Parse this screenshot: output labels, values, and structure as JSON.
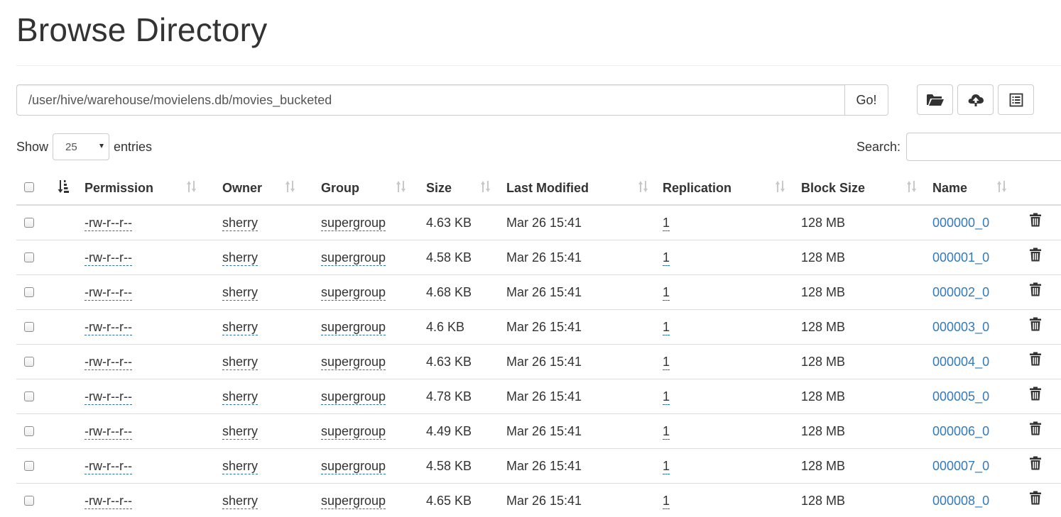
{
  "page": {
    "title": "Browse Directory"
  },
  "path_bar": {
    "value": "/user/hive/warehouse/movielens.db/movies_bucketed",
    "go_label": "Go!"
  },
  "toolbar": {
    "buttons": [
      {
        "name": "create-directory-button",
        "icon": "folder-open-icon"
      },
      {
        "name": "upload-button",
        "icon": "cloud-upload-icon"
      },
      {
        "name": "cut-paste-button",
        "icon": "list-icon"
      }
    ]
  },
  "table_controls": {
    "show_label": "Show",
    "entries_value": "25",
    "entries_label": "entries",
    "search_label": "Search:",
    "search_value": ""
  },
  "table": {
    "headers": {
      "permission": "Permission",
      "owner": "Owner",
      "group": "Group",
      "size": "Size",
      "last_modified": "Last Modified",
      "replication": "Replication",
      "block_size": "Block Size",
      "name": "Name"
    },
    "rows": [
      {
        "permission": "-rw-r--r--",
        "owner": "sherry",
        "group": "supergroup",
        "size": "4.63 KB",
        "last_modified": "Mar 26 15:41",
        "replication": "1",
        "block_size": "128 MB",
        "name": "000000_0"
      },
      {
        "permission": "-rw-r--r--",
        "owner": "sherry",
        "group": "supergroup",
        "size": "4.58 KB",
        "last_modified": "Mar 26 15:41",
        "replication": "1",
        "block_size": "128 MB",
        "name": "000001_0"
      },
      {
        "permission": "-rw-r--r--",
        "owner": "sherry",
        "group": "supergroup",
        "size": "4.68 KB",
        "last_modified": "Mar 26 15:41",
        "replication": "1",
        "block_size": "128 MB",
        "name": "000002_0"
      },
      {
        "permission": "-rw-r--r--",
        "owner": "sherry",
        "group": "supergroup",
        "size": "4.6 KB",
        "last_modified": "Mar 26 15:41",
        "replication": "1",
        "block_size": "128 MB",
        "name": "000003_0"
      },
      {
        "permission": "-rw-r--r--",
        "owner": "sherry",
        "group": "supergroup",
        "size": "4.63 KB",
        "last_modified": "Mar 26 15:41",
        "replication": "1",
        "block_size": "128 MB",
        "name": "000004_0"
      },
      {
        "permission": "-rw-r--r--",
        "owner": "sherry",
        "group": "supergroup",
        "size": "4.78 KB",
        "last_modified": "Mar 26 15:41",
        "replication": "1",
        "block_size": "128 MB",
        "name": "000005_0"
      },
      {
        "permission": "-rw-r--r--",
        "owner": "sherry",
        "group": "supergroup",
        "size": "4.49 KB",
        "last_modified": "Mar 26 15:41",
        "replication": "1",
        "block_size": "128 MB",
        "name": "000006_0"
      },
      {
        "permission": "-rw-r--r--",
        "owner": "sherry",
        "group": "supergroup",
        "size": "4.58 KB",
        "last_modified": "Mar 26 15:41",
        "replication": "1",
        "block_size": "128 MB",
        "name": "000007_0"
      },
      {
        "permission": "-rw-r--r--",
        "owner": "sherry",
        "group": "supergroup",
        "size": "4.65 KB",
        "last_modified": "Mar 26 15:41",
        "replication": "1",
        "block_size": "128 MB",
        "name": "000008_0"
      }
    ]
  },
  "colors": {
    "link": "#337ab7",
    "border": "#dddddd",
    "text": "#333333"
  }
}
